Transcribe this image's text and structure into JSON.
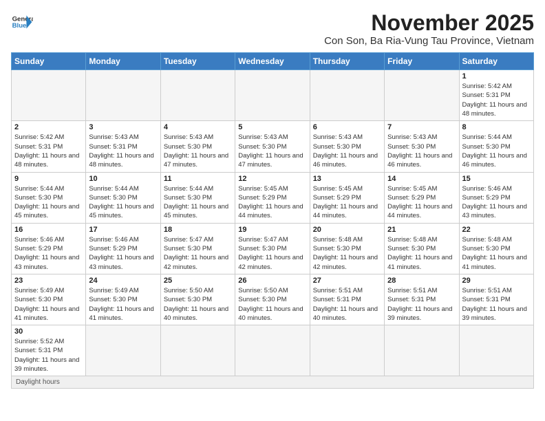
{
  "logo": {
    "text_general": "General",
    "text_blue": "Blue"
  },
  "header": {
    "month": "November 2025",
    "location": "Con Son, Ba Ria-Vung Tau Province, Vietnam"
  },
  "weekdays": [
    "Sunday",
    "Monday",
    "Tuesday",
    "Wednesday",
    "Thursday",
    "Friday",
    "Saturday"
  ],
  "weeks": [
    [
      {
        "day": "",
        "sunrise": "",
        "sunset": "",
        "daylight": ""
      },
      {
        "day": "",
        "sunrise": "",
        "sunset": "",
        "daylight": ""
      },
      {
        "day": "",
        "sunrise": "",
        "sunset": "",
        "daylight": ""
      },
      {
        "day": "",
        "sunrise": "",
        "sunset": "",
        "daylight": ""
      },
      {
        "day": "",
        "sunrise": "",
        "sunset": "",
        "daylight": ""
      },
      {
        "day": "",
        "sunrise": "",
        "sunset": "",
        "daylight": ""
      },
      {
        "day": "1",
        "sunrise": "Sunrise: 5:42 AM",
        "sunset": "Sunset: 5:31 PM",
        "daylight": "Daylight: 11 hours and 48 minutes."
      }
    ],
    [
      {
        "day": "2",
        "sunrise": "Sunrise: 5:42 AM",
        "sunset": "Sunset: 5:31 PM",
        "daylight": "Daylight: 11 hours and 48 minutes."
      },
      {
        "day": "3",
        "sunrise": "Sunrise: 5:43 AM",
        "sunset": "Sunset: 5:31 PM",
        "daylight": "Daylight: 11 hours and 48 minutes."
      },
      {
        "day": "4",
        "sunrise": "Sunrise: 5:43 AM",
        "sunset": "Sunset: 5:30 PM",
        "daylight": "Daylight: 11 hours and 47 minutes."
      },
      {
        "day": "5",
        "sunrise": "Sunrise: 5:43 AM",
        "sunset": "Sunset: 5:30 PM",
        "daylight": "Daylight: 11 hours and 47 minutes."
      },
      {
        "day": "6",
        "sunrise": "Sunrise: 5:43 AM",
        "sunset": "Sunset: 5:30 PM",
        "daylight": "Daylight: 11 hours and 46 minutes."
      },
      {
        "day": "7",
        "sunrise": "Sunrise: 5:43 AM",
        "sunset": "Sunset: 5:30 PM",
        "daylight": "Daylight: 11 hours and 46 minutes."
      },
      {
        "day": "8",
        "sunrise": "Sunrise: 5:44 AM",
        "sunset": "Sunset: 5:30 PM",
        "daylight": "Daylight: 11 hours and 46 minutes."
      }
    ],
    [
      {
        "day": "9",
        "sunrise": "Sunrise: 5:44 AM",
        "sunset": "Sunset: 5:30 PM",
        "daylight": "Daylight: 11 hours and 45 minutes."
      },
      {
        "day": "10",
        "sunrise": "Sunrise: 5:44 AM",
        "sunset": "Sunset: 5:30 PM",
        "daylight": "Daylight: 11 hours and 45 minutes."
      },
      {
        "day": "11",
        "sunrise": "Sunrise: 5:44 AM",
        "sunset": "Sunset: 5:30 PM",
        "daylight": "Daylight: 11 hours and 45 minutes."
      },
      {
        "day": "12",
        "sunrise": "Sunrise: 5:45 AM",
        "sunset": "Sunset: 5:29 PM",
        "daylight": "Daylight: 11 hours and 44 minutes."
      },
      {
        "day": "13",
        "sunrise": "Sunrise: 5:45 AM",
        "sunset": "Sunset: 5:29 PM",
        "daylight": "Daylight: 11 hours and 44 minutes."
      },
      {
        "day": "14",
        "sunrise": "Sunrise: 5:45 AM",
        "sunset": "Sunset: 5:29 PM",
        "daylight": "Daylight: 11 hours and 44 minutes."
      },
      {
        "day": "15",
        "sunrise": "Sunrise: 5:46 AM",
        "sunset": "Sunset: 5:29 PM",
        "daylight": "Daylight: 11 hours and 43 minutes."
      }
    ],
    [
      {
        "day": "16",
        "sunrise": "Sunrise: 5:46 AM",
        "sunset": "Sunset: 5:29 PM",
        "daylight": "Daylight: 11 hours and 43 minutes."
      },
      {
        "day": "17",
        "sunrise": "Sunrise: 5:46 AM",
        "sunset": "Sunset: 5:29 PM",
        "daylight": "Daylight: 11 hours and 43 minutes."
      },
      {
        "day": "18",
        "sunrise": "Sunrise: 5:47 AM",
        "sunset": "Sunset: 5:30 PM",
        "daylight": "Daylight: 11 hours and 42 minutes."
      },
      {
        "day": "19",
        "sunrise": "Sunrise: 5:47 AM",
        "sunset": "Sunset: 5:30 PM",
        "daylight": "Daylight: 11 hours and 42 minutes."
      },
      {
        "day": "20",
        "sunrise": "Sunrise: 5:48 AM",
        "sunset": "Sunset: 5:30 PM",
        "daylight": "Daylight: 11 hours and 42 minutes."
      },
      {
        "day": "21",
        "sunrise": "Sunrise: 5:48 AM",
        "sunset": "Sunset: 5:30 PM",
        "daylight": "Daylight: 11 hours and 41 minutes."
      },
      {
        "day": "22",
        "sunrise": "Sunrise: 5:48 AM",
        "sunset": "Sunset: 5:30 PM",
        "daylight": "Daylight: 11 hours and 41 minutes."
      }
    ],
    [
      {
        "day": "23",
        "sunrise": "Sunrise: 5:49 AM",
        "sunset": "Sunset: 5:30 PM",
        "daylight": "Daylight: 11 hours and 41 minutes."
      },
      {
        "day": "24",
        "sunrise": "Sunrise: 5:49 AM",
        "sunset": "Sunset: 5:30 PM",
        "daylight": "Daylight: 11 hours and 41 minutes."
      },
      {
        "day": "25",
        "sunrise": "Sunrise: 5:50 AM",
        "sunset": "Sunset: 5:30 PM",
        "daylight": "Daylight: 11 hours and 40 minutes."
      },
      {
        "day": "26",
        "sunrise": "Sunrise: 5:50 AM",
        "sunset": "Sunset: 5:30 PM",
        "daylight": "Daylight: 11 hours and 40 minutes."
      },
      {
        "day": "27",
        "sunrise": "Sunrise: 5:51 AM",
        "sunset": "Sunset: 5:31 PM",
        "daylight": "Daylight: 11 hours and 40 minutes."
      },
      {
        "day": "28",
        "sunrise": "Sunrise: 5:51 AM",
        "sunset": "Sunset: 5:31 PM",
        "daylight": "Daylight: 11 hours and 39 minutes."
      },
      {
        "day": "29",
        "sunrise": "Sunrise: 5:51 AM",
        "sunset": "Sunset: 5:31 PM",
        "daylight": "Daylight: 11 hours and 39 minutes."
      }
    ],
    [
      {
        "day": "30",
        "sunrise": "Sunrise: 5:52 AM",
        "sunset": "Sunset: 5:31 PM",
        "daylight": "Daylight: 11 hours and 39 minutes."
      },
      {
        "day": "",
        "sunrise": "",
        "sunset": "",
        "daylight": ""
      },
      {
        "day": "",
        "sunrise": "",
        "sunset": "",
        "daylight": ""
      },
      {
        "day": "",
        "sunrise": "",
        "sunset": "",
        "daylight": ""
      },
      {
        "day": "",
        "sunrise": "",
        "sunset": "",
        "daylight": ""
      },
      {
        "day": "",
        "sunrise": "",
        "sunset": "",
        "daylight": ""
      },
      {
        "day": "",
        "sunrise": "",
        "sunset": "",
        "daylight": ""
      }
    ]
  ],
  "footer": {
    "text": "Daylight hours"
  }
}
